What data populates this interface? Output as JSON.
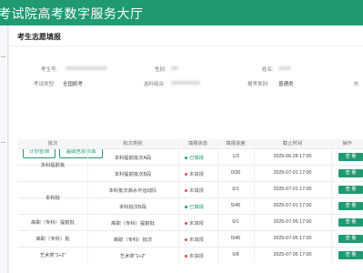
{
  "app": {
    "title": "考试院高考数字服务大厅"
  },
  "card": {
    "title": "考生志愿填报"
  },
  "info": {
    "exam_no_label": "考生号:",
    "gender_label": "性别:",
    "name_label": "姓名:",
    "exam_type_label": "考试类型:",
    "exam_type_value": "全国統考",
    "subjects_label": "选科组合:",
    "apply_type_label": "报考类别:",
    "apply_type_value": "普通类",
    "cut_label": "外"
  },
  "buttons": {
    "plan_query": "计划查询",
    "basic_info": "基础信息页面"
  },
  "table": {
    "headers": [
      "批次",
      "批次类别",
      "填报状态",
      "填报进度",
      "截止时间",
      "操作"
    ],
    "groups": [
      {
        "name": "本科提前批"
      },
      {
        "name": "本科批"
      },
      {
        "name": "高职（专科）提前批"
      },
      {
        "name": "高职（专科）批"
      },
      {
        "name": "艺术类“1+2”"
      }
    ],
    "rows": [
      {
        "category": "本科提前批次A段",
        "status": "已填报",
        "done": true,
        "progress": "1/3",
        "deadline": "2025-06-28 17:00",
        "action": "查 看"
      },
      {
        "category": "本科提前批次B段",
        "status": "未填报",
        "done": false,
        "progress": "0/30",
        "deadline": "2025-07-01 17:00",
        "action": "查 看"
      },
      {
        "category": "本科批次高水平运动队",
        "status": "未填报",
        "done": false,
        "progress": "0/1",
        "deadline": "2025-07-01 17:00",
        "action": "查 看"
      },
      {
        "category": "本科批次B段",
        "status": "已填报",
        "done": true,
        "progress": "5/45",
        "deadline": "2025-07-01 17:00",
        "action": "查 看"
      },
      {
        "category": "高职（专科）提前批",
        "status": "未填报",
        "done": false,
        "progress": "0/1",
        "deadline": "2025-07-05 17:00",
        "action": "查 看"
      },
      {
        "category": "高职（专科）批次",
        "status": "未填报",
        "done": false,
        "progress": "0/45",
        "deadline": "2025-07-05 17:00",
        "action": "查 看"
      },
      {
        "category": "艺术类“1+2”",
        "status": "未填报",
        "done": false,
        "progress": "0/8",
        "deadline": "2025-07-05 17:00",
        "action": "查 看"
      }
    ]
  },
  "colors": {
    "brand": "#1f9a73",
    "not_filled_dot": "#e5484d"
  }
}
